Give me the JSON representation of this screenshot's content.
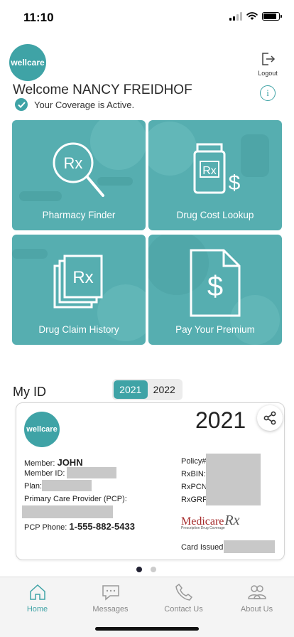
{
  "status_bar": {
    "time": "11:10"
  },
  "brand": {
    "logo_text": "wellcare",
    "accent_color": "#3fa3a6"
  },
  "header": {
    "logout_label": "Logout",
    "welcome": "Welcome NANCY FREIDHOF",
    "coverage_status": "Your Coverage is Active."
  },
  "tiles": [
    {
      "label": "Pharmacy Finder",
      "icon": "magnifier-rx-icon"
    },
    {
      "label": "Drug Cost Lookup",
      "icon": "pill-bottle-rx-dollar-icon"
    },
    {
      "label": "Drug Claim History",
      "icon": "stacked-rx-cards-icon"
    },
    {
      "label": "Pay Your Premium",
      "icon": "document-dollar-icon"
    }
  ],
  "my_id": {
    "title": "My ID",
    "years": [
      "2021",
      "2022"
    ],
    "selected_year": "2021"
  },
  "id_card": {
    "logo_text": "wellcare",
    "year": "2021",
    "member_label": "Member:",
    "member_name": "JOHN",
    "member_id_label": "Member ID:",
    "plan_label": "Plan:",
    "pcp_label": "Primary Care Provider (PCP):",
    "pcp_phone_label": "PCP Phone:",
    "pcp_phone": "1-555-882-5433",
    "policy_label": "Policy#",
    "rxbin_label": "RxBIN:",
    "rxpcn_label": "RxPCN",
    "rxgrp_label": "RxGRP:",
    "medicare_logo_text": "Medicare",
    "medicare_logo_rx": "Rx",
    "medicare_logo_sub": "Prescription Drug Coverage",
    "card_issued_label": "Card Issued:"
  },
  "pagination": {
    "pages": 2,
    "current": 1
  },
  "bottom_nav": [
    {
      "label": "Home",
      "icon": "home-icon",
      "active": true
    },
    {
      "label": "Messages",
      "icon": "chat-bubble-icon",
      "active": false
    },
    {
      "label": "Contact Us",
      "icon": "phone-icon",
      "active": false
    },
    {
      "label": "About Us",
      "icon": "people-icon",
      "active": false
    }
  ]
}
